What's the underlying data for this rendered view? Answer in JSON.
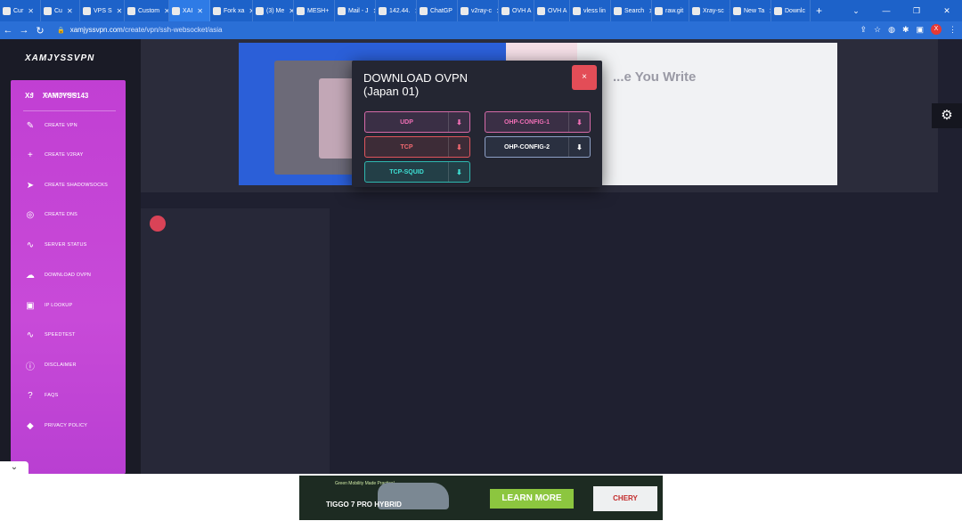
{
  "browser": {
    "tabs": [
      {
        "label": "Cur"
      },
      {
        "label": "Cu"
      },
      {
        "label": "VPS S"
      },
      {
        "label": "Custom"
      },
      {
        "label": "XAI"
      },
      {
        "label": "Fork xa"
      },
      {
        "label": "(3) Me"
      },
      {
        "label": "MESH+"
      },
      {
        "label": "Mail - J"
      },
      {
        "label": "142.44."
      },
      {
        "label": "ChatGP"
      },
      {
        "label": "v2ray-c"
      },
      {
        "label": "OVH A"
      },
      {
        "label": "OVH A"
      },
      {
        "label": "vless lin"
      },
      {
        "label": "Search"
      },
      {
        "label": "raw.git"
      },
      {
        "label": "Xray-sc"
      },
      {
        "label": "New Ta"
      },
      {
        "label": "Downlc"
      }
    ],
    "new_tab": "+",
    "window_controls": [
      "⌄",
      "—",
      "❐",
      "✕"
    ],
    "url_host": "xamjyssvpn.com",
    "url_path": "/create/vpn/ssh-websocket/asia",
    "profile_initial": "X"
  },
  "sidebar": {
    "brand": "XAMJYSSVPN",
    "user_initials": "XJ",
    "username": "XAMJYSS143",
    "items": [
      {
        "label": "DASHBOARD",
        "icon": "◔"
      },
      {
        "label": "CREATE VPN",
        "icon": "✎"
      },
      {
        "label": "CREATE V2RAY",
        "icon": "+"
      },
      {
        "label": "CREATE SHADOWSOCKS",
        "icon": "➤"
      },
      {
        "label": "CREATE DNS",
        "icon": "◎"
      },
      {
        "label": "SERVER STATUS",
        "icon": "∿"
      },
      {
        "label": "DOWNLOAD OVPN",
        "icon": "☁"
      },
      {
        "label": "IP LOOKUP",
        "icon": "▣"
      },
      {
        "label": "SPEEDTEST",
        "icon": "∿"
      },
      {
        "label": "DISCLAIMER",
        "icon": "ⓘ"
      },
      {
        "label": "FAQS",
        "icon": "?"
      },
      {
        "label": "PRIVACY POLICY",
        "icon": "◆"
      }
    ]
  },
  "hero": {
    "title": "...e You Write"
  },
  "modal": {
    "title_line1": "DOWNLOAD OVPN",
    "title_line2": "(Japan 01)",
    "close_label": "×",
    "buttons": {
      "udp": "UDP",
      "tcp": "TCP",
      "tcp_squid": "TCP-SQUID",
      "ohp_config_1": "OHP-CONFIG-1",
      "ohp_config_2": "OHP-CONFIG-2"
    }
  },
  "ad": {
    "tagline": "Green Mobility Made Practical",
    "model": "TIGGO 7 PRO HYBRID",
    "cta": "LEARN MORE",
    "brand": "CHERY"
  },
  "colors": {
    "tabbar": "#1d62c9",
    "sidebar_gradient": "#c13fd3",
    "modal_bg": "#242632",
    "close_red": "#e34d57"
  }
}
